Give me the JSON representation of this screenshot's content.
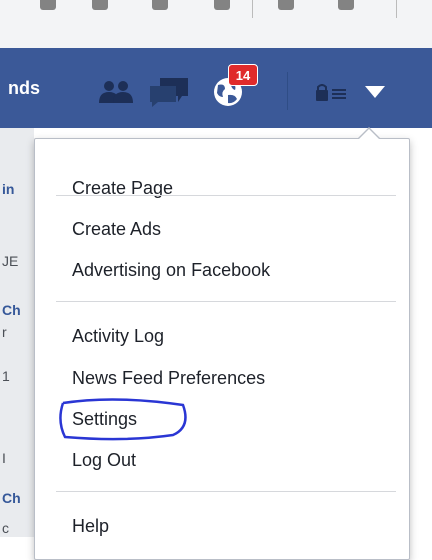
{
  "topbar": {
    "partial_label": "nds",
    "notification_count": "14"
  },
  "left_strip": {
    "fragments": [
      "in",
      "JE",
      "Ch",
      "r",
      "1",
      "I",
      "Ch",
      "c"
    ]
  },
  "menu": {
    "items": [
      {
        "label": "Create Page"
      },
      {
        "label": "Create Ads"
      },
      {
        "label": "Advertising on Facebook"
      },
      {
        "label": "Activity Log"
      },
      {
        "label": "News Feed Preferences"
      },
      {
        "label": "Settings"
      },
      {
        "label": "Log Out"
      },
      {
        "label": "Help"
      }
    ]
  },
  "colors": {
    "topbar": "#3b5998",
    "badge": "#e02b2b",
    "highlight_circle": "#2a36d4"
  }
}
